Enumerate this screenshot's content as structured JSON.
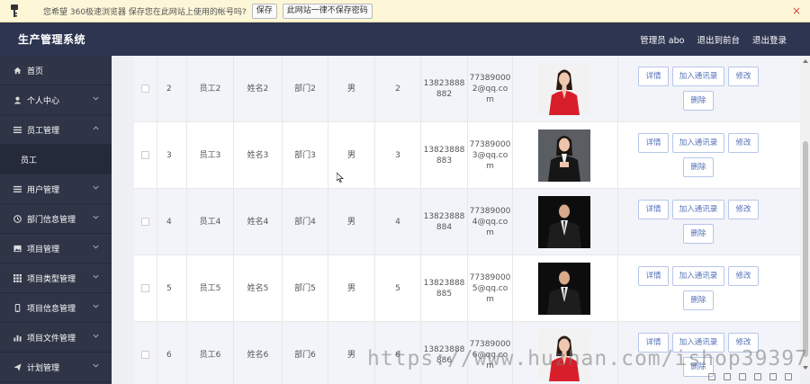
{
  "password_bar": {
    "message": "您希望 360极速浏览器 保存您在此网站上使用的帐号吗?",
    "save_button": "保存",
    "never_button": "此网站一律不保存密码",
    "close": "×"
  },
  "header": {
    "brand": "生产管理系统",
    "admin": "管理员 abo",
    "frontend": "退出到前台",
    "logout": "退出登录"
  },
  "sidebar": {
    "items": [
      {
        "label": "首页",
        "icon": "home-icon",
        "chevron": false
      },
      {
        "label": "个人中心",
        "icon": "user-icon",
        "chevron": true
      },
      {
        "label": "员工管理",
        "icon": "list-icon",
        "chevron": true,
        "open": true
      },
      {
        "label": "员工",
        "icon": "",
        "chevron": false,
        "sub": true
      },
      {
        "label": "用户管理",
        "icon": "list-icon",
        "chevron": true
      },
      {
        "label": "部门信息管理",
        "icon": "clock-icon",
        "chevron": true
      },
      {
        "label": "项目管理",
        "icon": "image-icon",
        "chevron": true
      },
      {
        "label": "项目类型管理",
        "icon": "grid-icon",
        "chevron": true
      },
      {
        "label": "项目信息管理",
        "icon": "phone-icon",
        "chevron": true
      },
      {
        "label": "项目文件管理",
        "icon": "bar-chart-icon",
        "chevron": true
      },
      {
        "label": "计划管理",
        "icon": "send-icon",
        "chevron": true
      }
    ]
  },
  "table": {
    "rows": [
      {
        "idx": "2",
        "name": "员工2",
        "realname": "姓名2",
        "dept": "部门2",
        "gender": "男",
        "level": "2",
        "phone": [
          "13823888",
          "882"
        ],
        "email": [
          "77389000",
          "2@qq.co",
          "m"
        ],
        "photo": "woman-red"
      },
      {
        "idx": "3",
        "name": "员工3",
        "realname": "姓名3",
        "dept": "部门3",
        "gender": "男",
        "level": "3",
        "phone": [
          "13823888",
          "883"
        ],
        "email": [
          "77389000",
          "3@qq.co",
          "m"
        ],
        "photo": "woman-dark"
      },
      {
        "idx": "4",
        "name": "员工4",
        "realname": "姓名4",
        "dept": "部门4",
        "gender": "男",
        "level": "4",
        "phone": [
          "13823888",
          "884"
        ],
        "email": [
          "77389000",
          "4@qq.co",
          "m"
        ],
        "photo": "man"
      },
      {
        "idx": "5",
        "name": "员工5",
        "realname": "姓名5",
        "dept": "部门5",
        "gender": "男",
        "level": "5",
        "phone": [
          "13823888",
          "885"
        ],
        "email": [
          "77389000",
          "5@qq.co",
          "m"
        ],
        "photo": "man"
      },
      {
        "idx": "6",
        "name": "员工6",
        "realname": "姓名6",
        "dept": "部门6",
        "gender": "男",
        "level": "6",
        "phone": [
          "13823888",
          "886"
        ],
        "email": [
          "77389000",
          "6@qq.co",
          "m"
        ],
        "photo": "woman-red"
      }
    ],
    "actions": {
      "detail": "详情",
      "add_contact": "加入通讯录",
      "edit": "修改",
      "delete": "删除"
    }
  },
  "watermark": "https://www.huzhan.com/ishop39397",
  "colors": {
    "header": "#2d3550",
    "sidebar": "#2f3547",
    "accent": "#5470b8",
    "stripe": "#f2f4f9"
  }
}
